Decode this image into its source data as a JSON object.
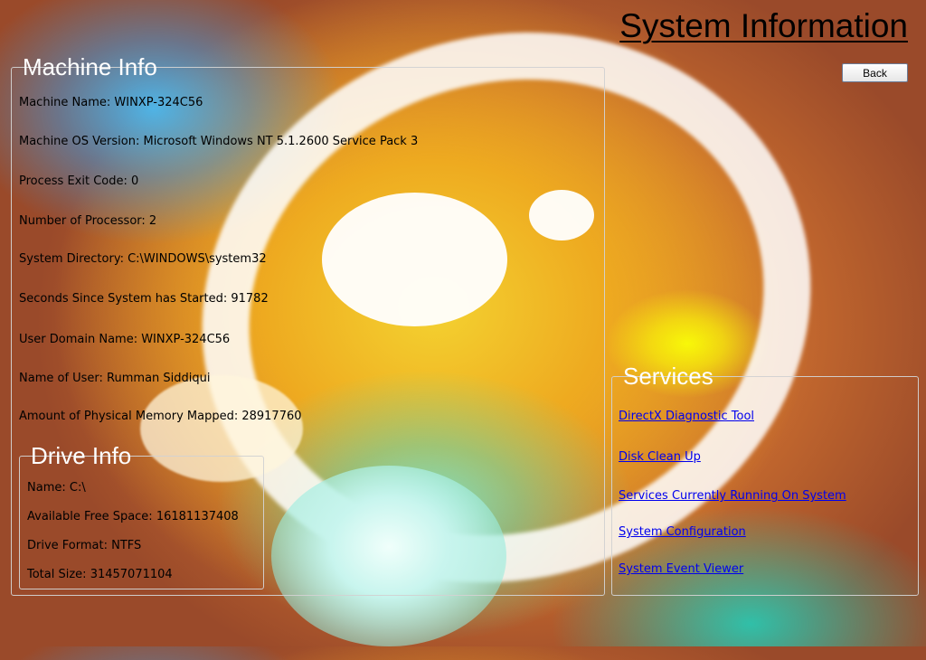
{
  "header": {
    "title": "System Information",
    "back_label": "Back"
  },
  "machine_info": {
    "title": "Machine Info",
    "items": [
      "Machine Name: WINXP-324C56",
      "Machine OS Version: Microsoft Windows NT 5.1.2600 Service Pack 3",
      "Process Exit Code: 0",
      "Number of Processor: 2",
      "System Directory: C:\\WINDOWS\\system32",
      "Seconds Since System has Started: 91782",
      "User Domain Name: WINXP-324C56",
      "Name of User: Rumman Siddiqui",
      "Amount of Physical Memory Mapped: 28917760"
    ]
  },
  "drive_info": {
    "title": "Drive Info",
    "items": [
      "Name: C:\\",
      "Available Free Space: 16181137408",
      "Drive Format: NTFS",
      "Total Size: 31457071104"
    ]
  },
  "services": {
    "title": "Services",
    "links": [
      "DirectX Diagnostic Tool",
      "Disk Clean Up",
      "Services Currently Running On System",
      "System Configuration",
      "System Event Viewer"
    ]
  }
}
